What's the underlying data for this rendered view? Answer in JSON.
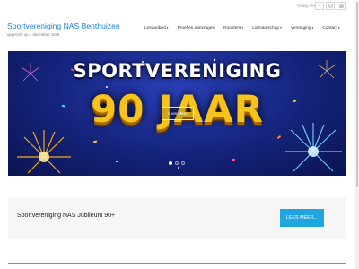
{
  "utility": {
    "help_link": "Vraag ons",
    "social_icons": [
      "facebook-icon",
      "instagram-icon",
      "mail-icon"
    ]
  },
  "header": {
    "site_title": "Sportvereniging NAS Benthuizen",
    "site_subtitle": "opgericht op 4 december 1935"
  },
  "nav": {
    "items": [
      {
        "label": "Lesaanbod",
        "has_dropdown": true
      },
      {
        "label": "Proefles aanvragen",
        "has_dropdown": false
      },
      {
        "label": "Roosters",
        "has_dropdown": true
      },
      {
        "label": "Lidmaatschap",
        "has_dropdown": true
      },
      {
        "label": "Vereniging",
        "has_dropdown": true
      },
      {
        "label": "Contact",
        "has_dropdown": true
      }
    ],
    "caret": "▾"
  },
  "hero": {
    "line1": "SPORTVERENIGING",
    "line2": "90 JAAR",
    "button_label": "Lees Meer",
    "slides_total": 3,
    "active_slide": 1
  },
  "callout": {
    "text": "Sportvereniging NAS Jubileum 90+",
    "button_label": "LEES MEER..."
  },
  "colors": {
    "brand_blue": "#1e7fd1",
    "button_blue": "#1fa6df",
    "hero_gold": "#f6c21c",
    "hero_bg": "#14237a"
  }
}
